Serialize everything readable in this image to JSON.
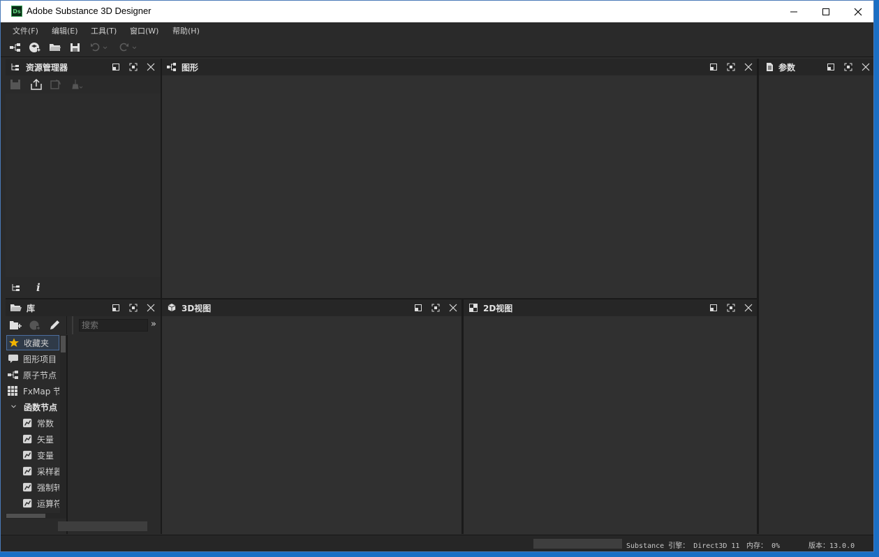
{
  "window": {
    "title": "Adobe Substance 3D Designer",
    "logo": "Ds"
  },
  "menu": [
    {
      "label": "文件(F)"
    },
    {
      "label": "编辑(E)"
    },
    {
      "label": "工具(T)"
    },
    {
      "label": "窗口(W)"
    },
    {
      "label": "帮助(H)"
    }
  ],
  "toolbar_icons": [
    "new-graph-icon",
    "new-package-icon",
    "open-folder-icon",
    "save-icon",
    "undo-icon",
    "redo-icon"
  ],
  "panels": {
    "explorer": {
      "title": "资源管理器"
    },
    "graph": {
      "title": "图形"
    },
    "params": {
      "title": "参数"
    },
    "library": {
      "title": "库"
    },
    "view3d": {
      "title": "3D视图"
    },
    "view2d": {
      "title": "2D视图"
    }
  },
  "library": {
    "search_placeholder": "搜索",
    "more": "»",
    "items": [
      {
        "label": "收藏夹",
        "icon": "star-icon"
      },
      {
        "label": "图形项目",
        "icon": "comment-icon"
      },
      {
        "label": "原子节点",
        "icon": "node-icon"
      },
      {
        "label": "FxMap 节",
        "icon": "grid-icon"
      },
      {
        "label": "函数节点",
        "icon": "chevron-down-icon"
      },
      {
        "label": "常数",
        "icon": "function-icon"
      },
      {
        "label": "矢量",
        "icon": "function-icon"
      },
      {
        "label": "变量",
        "icon": "function-icon"
      },
      {
        "label": "采样器",
        "icon": "function-icon"
      },
      {
        "label": "强制转",
        "icon": "function-icon"
      },
      {
        "label": "运算符",
        "icon": "function-icon"
      }
    ]
  },
  "status": {
    "engine": "Substance 引擎： Direct3D 11",
    "memory": "内存： 0%",
    "version": "版本：13.0.0"
  },
  "colors": {
    "accent": "#3aa65a",
    "background": "#2d2d2d",
    "star": "#f0b400"
  }
}
